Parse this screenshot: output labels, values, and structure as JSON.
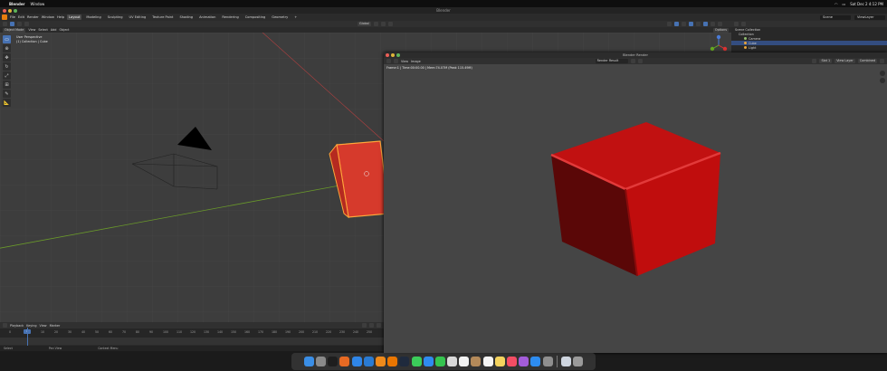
{
  "menubar": {
    "app": "Blender",
    "menu": [
      "Window"
    ],
    "clock": "Sat Dec 2 4:12 PM"
  },
  "window": {
    "title": "Blender"
  },
  "topbar": {
    "menus": [
      "File",
      "Edit",
      "Render",
      "Window",
      "Help"
    ],
    "tabs": [
      "Layout",
      "Modeling",
      "Sculpting",
      "UV Editing",
      "Texture Paint",
      "Shading",
      "Animation",
      "Rendering",
      "Compositing",
      "Geometry"
    ],
    "scene_field": "Scene",
    "viewlayer_field": "ViewLayer"
  },
  "viewport": {
    "mode": "Object Mode",
    "menus": [
      "View",
      "Select",
      "Add",
      "Object"
    ],
    "transform": "Global",
    "options": "Options",
    "info_line1": "User Perspective",
    "info_line2": "(1) Collection | Cube"
  },
  "outliner": {
    "title": "Scene Collection",
    "rows": [
      {
        "label": "Scene Collection",
        "selected": false
      },
      {
        "label": "Collection",
        "selected": false
      },
      {
        "label": "Camera",
        "selected": false,
        "color": "#8fbc6f"
      },
      {
        "label": "Cube",
        "selected": true,
        "color": "#e8a43a"
      },
      {
        "label": "Light",
        "selected": false,
        "color": "#e8a43a"
      }
    ]
  },
  "render_window": {
    "title": "Blender Render",
    "menus": [
      "View",
      "Image"
    ],
    "slot": "Render Result",
    "slot_num": "Slot 1",
    "view_layer": "View Layer",
    "pass": "Combined",
    "stats": "Frame:1 | Time:00:00.00 | Mem:74.07M (Peak 115.49M)"
  },
  "timeline": {
    "menus": [
      "Playback",
      "Keying",
      "View",
      "Marker"
    ],
    "current_frame": "1",
    "ticks": [
      "0",
      "10",
      "20",
      "30",
      "40",
      "50",
      "60",
      "70",
      "80",
      "90",
      "100",
      "110",
      "120",
      "130",
      "140",
      "150",
      "160",
      "170",
      "180",
      "190",
      "200",
      "210",
      "220",
      "230",
      "240",
      "250"
    ]
  },
  "statusbar": {
    "left": "Select",
    "mid": "Pan View",
    "right": "Context Menu"
  },
  "dock": {
    "apps": [
      {
        "name": "finder",
        "color": "#3a8ee6"
      },
      {
        "name": "launchpad",
        "color": "#8a8a8a"
      },
      {
        "name": "terminal",
        "color": "#1e1e1e"
      },
      {
        "name": "firefox",
        "color": "#e86a23"
      },
      {
        "name": "safari",
        "color": "#2f86e8"
      },
      {
        "name": "vscode",
        "color": "#2a7bd3"
      },
      {
        "name": "sublime",
        "color": "#ef8a1b"
      },
      {
        "name": "blender",
        "color": "#ea7600"
      },
      {
        "name": "app-dark",
        "color": "#1f2a3d"
      },
      {
        "name": "messages",
        "color": "#3bcc5a"
      },
      {
        "name": "mail",
        "color": "#2f8bf0"
      },
      {
        "name": "facetime",
        "color": "#35c44f"
      },
      {
        "name": "photos",
        "color": "#d9d9d9"
      },
      {
        "name": "calendar",
        "color": "#f2f2f2"
      },
      {
        "name": "contacts",
        "color": "#b48a5a"
      },
      {
        "name": "reminders",
        "color": "#f5f5f5"
      },
      {
        "name": "notes",
        "color": "#f4d35e"
      },
      {
        "name": "music",
        "color": "#f34d64"
      },
      {
        "name": "podcasts",
        "color": "#a35cd9"
      },
      {
        "name": "appstore",
        "color": "#2d8cf0"
      },
      {
        "name": "settings",
        "color": "#8f8f8f"
      },
      {
        "name": "preview",
        "color": "#cfd6e0"
      },
      {
        "name": "trash",
        "color": "#9a9a9a"
      }
    ]
  }
}
